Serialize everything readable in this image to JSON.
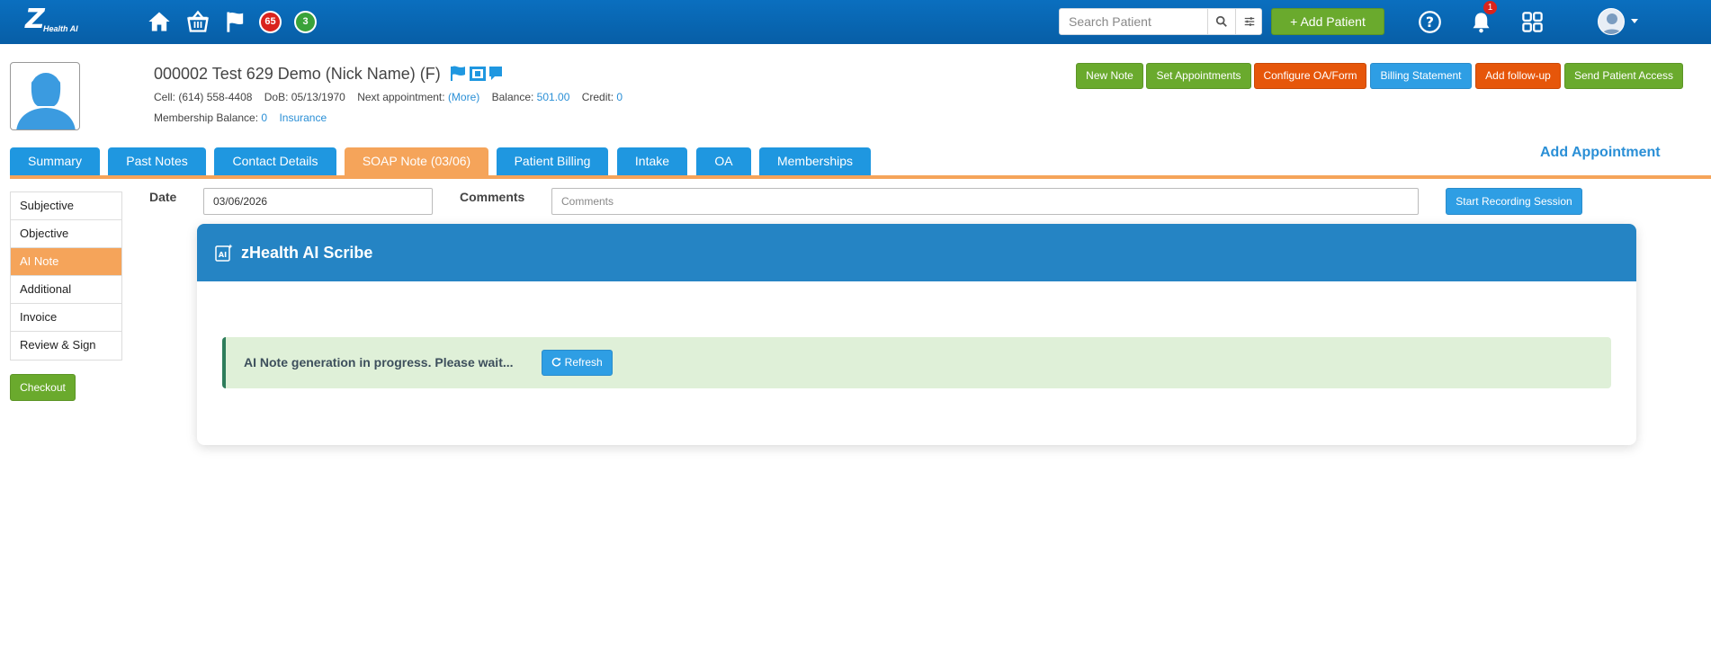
{
  "topbar": {
    "logo_mark": "Z",
    "logo_text": "Health AI",
    "red_count": "65",
    "green_count": "3",
    "search_placeholder": "Search Patient",
    "add_patient_label": "+ Add Patient",
    "notification_count": "1"
  },
  "patient": {
    "name_line": "000002 Test 629 Demo  (Nick Name) (F)",
    "cell_label": "Cell:",
    "cell_value": "(614) 558-4408",
    "dob_label": "DoB:",
    "dob_value": "05/13/1970",
    "next_appt_label": "Next appointment:",
    "next_appt_link": "(More)",
    "balance_label": "Balance:",
    "balance_value": "501.00",
    "credit_label": "Credit:",
    "credit_value": "0",
    "membership_label": "Membership Balance:",
    "membership_value": "0",
    "insurance_link": "Insurance"
  },
  "actions": {
    "new_note": "New Note",
    "set_appointments": "Set Appointments",
    "configure_oa": "Configure OA/Form",
    "billing_statement": "Billing Statement",
    "add_followup": "Add follow-up",
    "send_access": "Send Patient Access"
  },
  "tabs": [
    "Summary",
    "Past Notes",
    "Contact Details",
    "SOAP Note (03/06)",
    "Patient Billing",
    "Intake",
    "OA",
    "Memberships"
  ],
  "add_appointment": "Add Appointment",
  "side_menu": [
    "Subjective",
    "Objective",
    "AI Note",
    "Additional",
    "Invoice",
    "Review & Sign"
  ],
  "checkout_label": "Checkout",
  "form": {
    "date_label": "Date",
    "date_value": "03/06/2026",
    "comments_label": "Comments",
    "comments_placeholder": "Comments",
    "start_recording": "Start Recording Session"
  },
  "scribe": {
    "title": "zHealth AI Scribe",
    "status": "AI Note generation in progress. Please wait...",
    "refresh_label": "Refresh"
  },
  "colors": {
    "topbar": "#0a6fbf",
    "green": "#6aaa2d",
    "orange": "#e6560a",
    "blue": "#2e9ee4",
    "active_tab": "#f5a45a",
    "scribe_header": "#2584c4",
    "status_bg": "#dff0d8"
  }
}
